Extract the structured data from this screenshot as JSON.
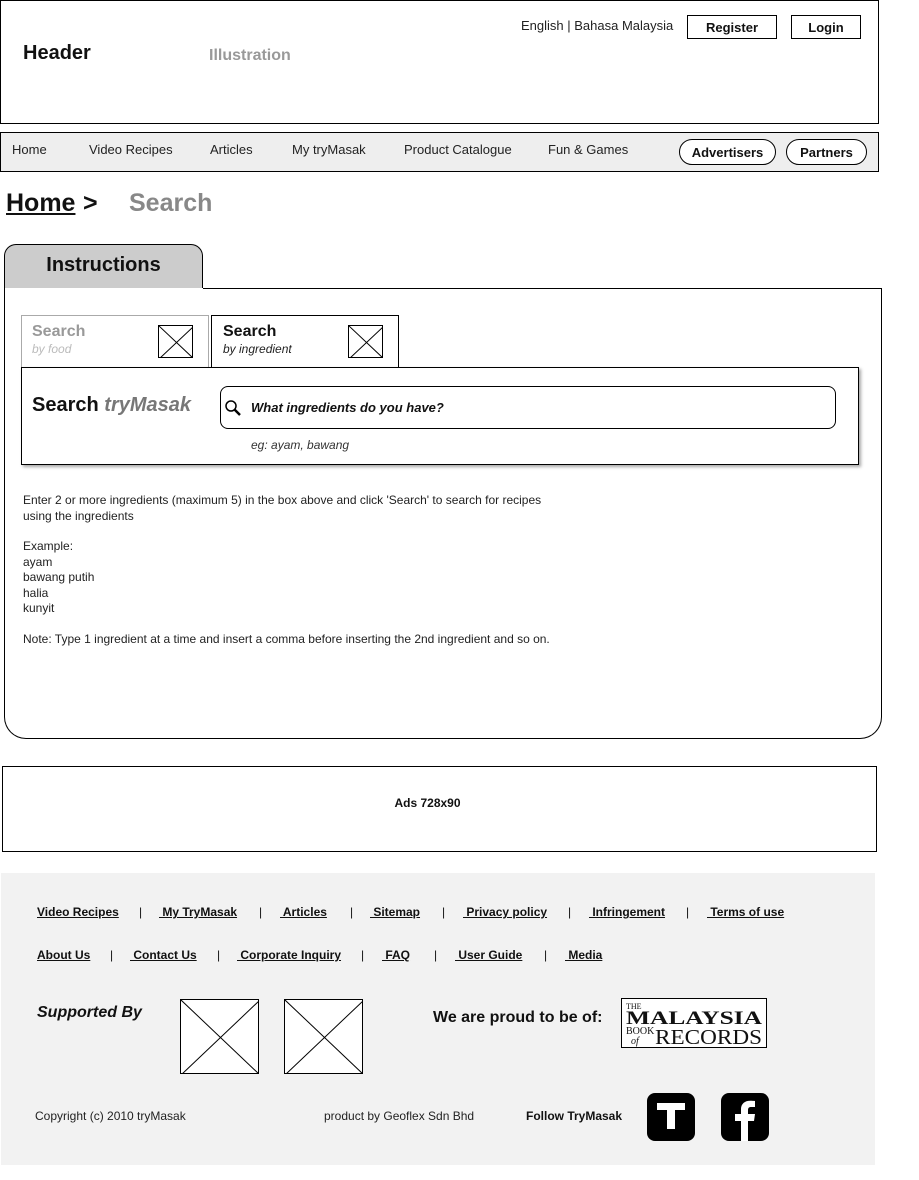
{
  "header": {
    "title": "Header",
    "illustration": "Illustration",
    "language": "English | Bahasa Malaysia",
    "register_label": "Register",
    "login_label": "Login"
  },
  "nav": {
    "items": [
      {
        "label": "Home"
      },
      {
        "label": "Video Recipes"
      },
      {
        "label": "Articles"
      },
      {
        "label": "My tryMasak"
      },
      {
        "label": "Product Catalogue"
      },
      {
        "label": "Fun & Games"
      }
    ],
    "advertisers_label": "Advertisers",
    "partners_label": "Partners"
  },
  "breadcrumb": {
    "home": "Home",
    "separator": ">",
    "current": "Search"
  },
  "instructions": {
    "tab_label": "Instructions",
    "search_tabs": [
      {
        "title": "Search",
        "subtitle": "by food",
        "active": false
      },
      {
        "title": "Search",
        "subtitle": "by ingredient",
        "active": true
      }
    ],
    "search_label_prefix": "Search",
    "search_label_brand": "tryMasak",
    "search_placeholder": "What ingredients do you have?",
    "search_example": "eg: ayam, bawang",
    "paragraph_line1": "Enter 2 or more ingredients (maximum 5) in the box above and click 'Search' to search for recipes",
    "paragraph_line2": "using the ingredients",
    "example_heading": "Example:",
    "examples": [
      "ayam",
      "bawang putih",
      "halia",
      "kunyit"
    ],
    "note": "Note: Type 1 ingredient at a time and insert a comma before inserting the 2nd ingredient and so on."
  },
  "ads": {
    "label": "Ads 728x90"
  },
  "footer": {
    "links_row1": [
      "Video Recipes",
      " My TryMasak",
      " Articles",
      " Sitemap",
      " Privacy policy",
      " Infringement",
      " Terms of use"
    ],
    "links_row2": [
      "About Us",
      " Contact Us",
      " Corporate Inquiry",
      " FAQ",
      " User Guide",
      " Media"
    ],
    "separator": "|",
    "supported_by": "Supported By",
    "proud": "We are proud to be of:",
    "mbr_logo_text": "THE MALAYSIA BOOK of RECORDS",
    "copyright": "Copyright (c) 2010 tryMasak",
    "product_by": "product by Geoflex Sdn Bhd",
    "follow": "Follow TryMasak",
    "social_icons": [
      "twitter-icon",
      "facebook-icon"
    ]
  },
  "colors": {
    "nav_background": "#eeeeee",
    "instructions_tab": "#cccccc",
    "footer_background": "#f2f2f2",
    "muted_text": "#888888"
  }
}
